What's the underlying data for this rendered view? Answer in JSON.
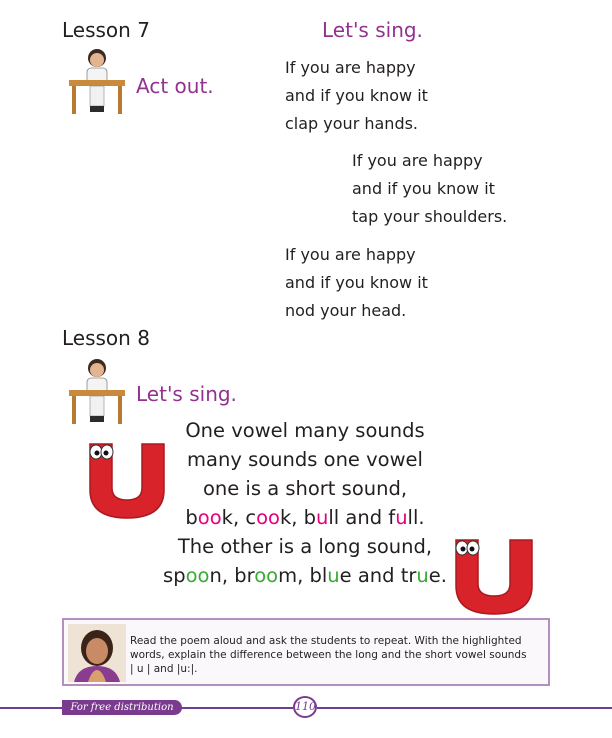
{
  "lesson7": {
    "title": "Lesson 7",
    "act_out": "Act out.",
    "lets_sing": "Let's sing.",
    "song_stanzas": [
      [
        "If you are happy",
        "and if you know it",
        "clap your hands."
      ],
      [
        "If you are happy",
        "and if you know it",
        "tap your shoulders."
      ],
      [
        "If you are happy",
        "and if you know it",
        "nod your head."
      ]
    ]
  },
  "lesson8": {
    "title": "Lesson 8",
    "lets_sing": "Let's sing.",
    "poem": {
      "line1": "One vowel many sounds",
      "line2": "many sounds one vowel",
      "line3": "one is a short sound,",
      "line4": {
        "w1a": "b",
        "w1b": "oo",
        "w1c": "k, c",
        "w2b": "oo",
        "w2c": "k, b",
        "w3b": "u",
        "w3c": "ll and f",
        "w4b": "u",
        "w4c": "ll."
      },
      "line5": "The other is a long sound,",
      "line6": {
        "a": "sp",
        "b": "oo",
        "c": "n, br",
        "d": "oo",
        "e": "m, bl",
        "f": "u",
        "g": "e and tr",
        "h": "u",
        "i": "e."
      }
    }
  },
  "teacher_note": {
    "text_line1": "Read the poem aloud and ask the students to repeat. With the highlighted",
    "text_line2": "words, explain the difference between the long and the short vowel sounds",
    "text_line3": "| u | and |u:|."
  },
  "footer": {
    "distribution": "For free distribution",
    "page_number": "110"
  },
  "colors": {
    "accent_purple": "#93328e",
    "highlight_pink": "#e6007e",
    "highlight_green": "#3aaa35",
    "letter_red": "#d8232a"
  }
}
